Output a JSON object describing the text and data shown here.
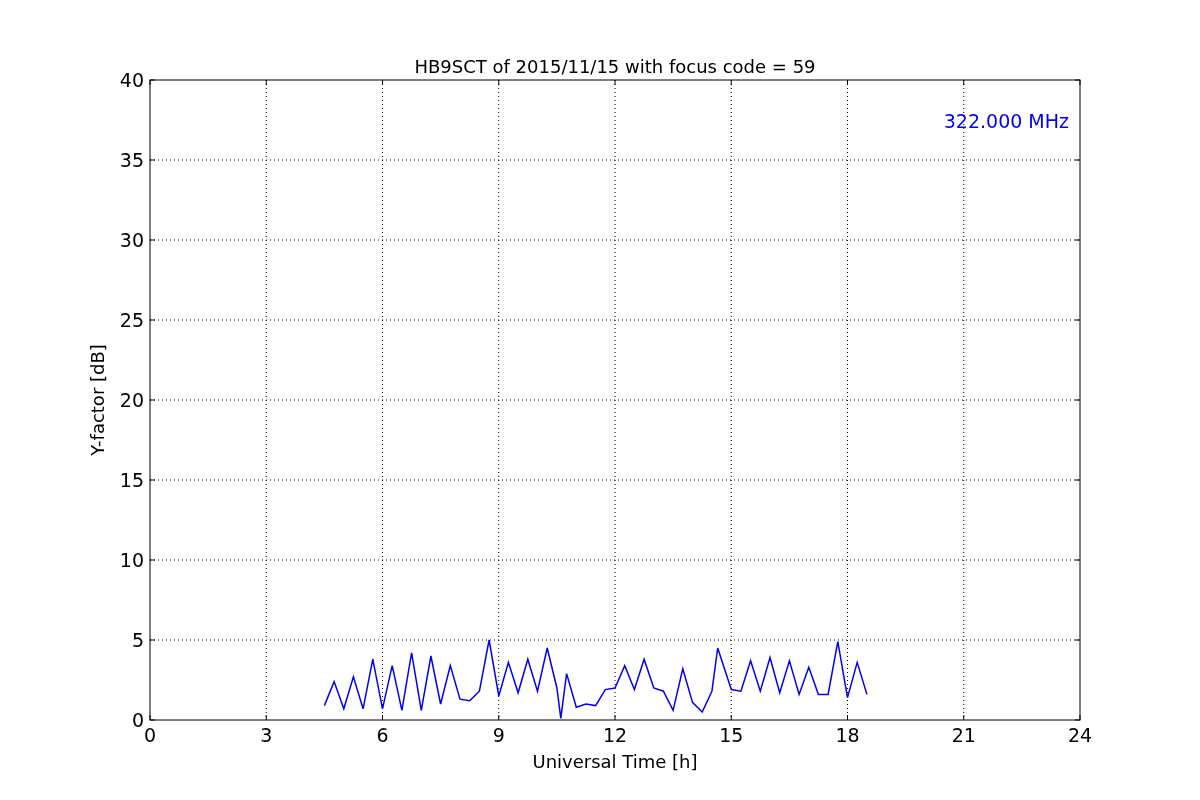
{
  "chart_data": {
    "type": "line",
    "title": "HB9SCT of 2015/11/15 with focus code = 59",
    "xlabel": "Universal Time [h]",
    "ylabel": "Y-factor [dB]",
    "xlim": [
      0,
      24
    ],
    "ylim": [
      0,
      40
    ],
    "xticks": [
      0,
      3,
      6,
      9,
      12,
      15,
      18,
      21,
      24
    ],
    "yticks": [
      0,
      5,
      10,
      15,
      20,
      25,
      30,
      35,
      40
    ],
    "x": [
      4.5,
      4.75,
      5.0,
      5.25,
      5.5,
      5.75,
      6.0,
      6.25,
      6.5,
      6.75,
      7.0,
      7.25,
      7.5,
      7.75,
      8.0,
      8.25,
      8.5,
      8.75,
      9.0,
      9.25,
      9.5,
      9.75,
      10.0,
      10.25,
      10.5,
      10.6,
      10.75,
      11.0,
      11.25,
      11.5,
      11.75,
      12.0,
      12.25,
      12.5,
      12.75,
      13.0,
      13.25,
      13.5,
      13.75,
      14.0,
      14.25,
      14.5,
      14.65,
      15.0,
      15.25,
      15.5,
      15.75,
      16.0,
      16.25,
      16.5,
      16.75,
      17.0,
      17.25,
      17.5,
      17.75,
      18.0,
      18.25,
      18.5
    ],
    "series": [
      {
        "name": "322.000 MHz",
        "color": "#0000ff",
        "values": [
          0.9,
          2.4,
          0.7,
          2.7,
          0.7,
          3.8,
          0.7,
          3.4,
          0.6,
          4.2,
          0.6,
          4.0,
          1.0,
          3.4,
          1.3,
          1.2,
          1.8,
          5.0,
          1.5,
          3.6,
          1.7,
          3.8,
          1.8,
          4.5,
          2.0,
          0.1,
          2.9,
          0.8,
          1.0,
          0.9,
          1.9,
          2.0,
          3.4,
          1.9,
          3.8,
          2.0,
          1.8,
          0.6,
          3.2,
          1.1,
          0.5,
          1.8,
          4.5,
          1.9,
          1.8,
          3.7,
          1.8,
          3.9,
          1.7,
          3.7,
          1.6,
          3.3,
          1.6,
          1.6,
          4.9,
          1.4,
          3.6,
          1.6
        ]
      }
    ],
    "grid": true
  }
}
